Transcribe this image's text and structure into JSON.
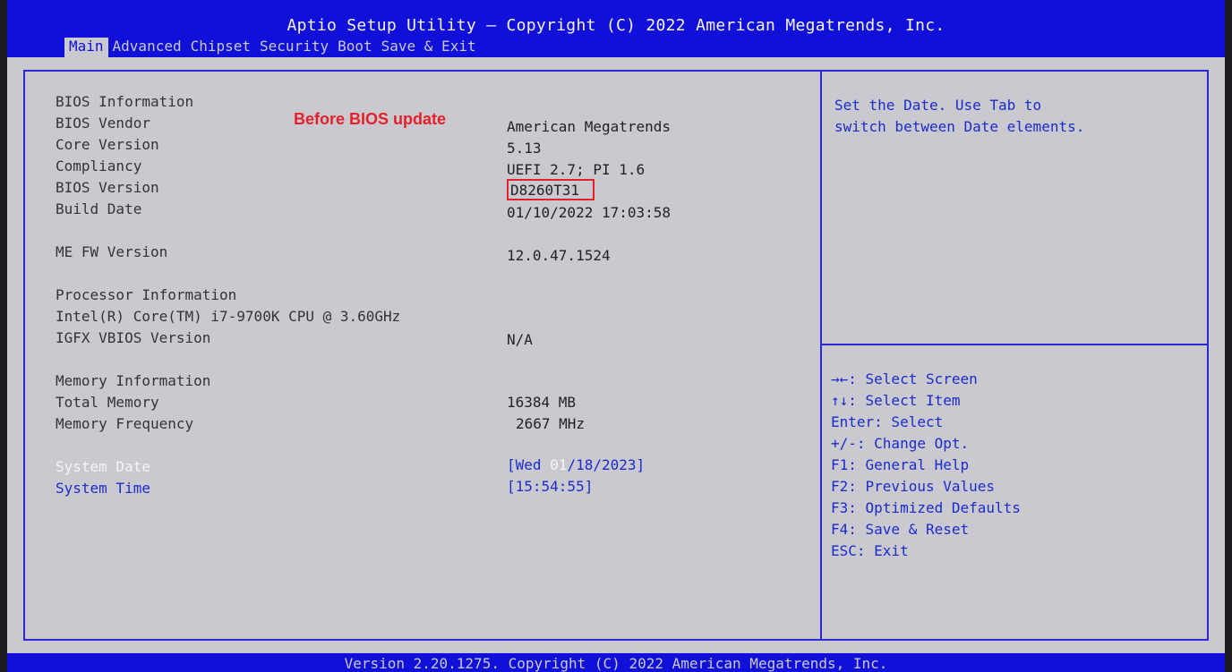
{
  "header": {
    "title": "Aptio Setup Utility – Copyright (C) 2022 American Megatrends, Inc.",
    "tabs": [
      "Main",
      "Advanced",
      "Chipset",
      "Security",
      "Boot",
      "Save & Exit"
    ]
  },
  "main": {
    "bios_info_heading": "BIOS Information",
    "bios_vendor_label": "BIOS Vendor",
    "bios_vendor_value": "American Megatrends",
    "core_version_label": "Core Version",
    "core_version_value": "5.13",
    "compliancy_label": "Compliancy",
    "compliancy_value": "UEFI 2.7; PI 1.6",
    "bios_version_label": "BIOS Version",
    "bios_version_value": "D8260T31",
    "build_date_label": "Build Date",
    "build_date_value": "01/10/2022 17:03:58",
    "me_fw_label": "ME FW Version",
    "me_fw_value": "12.0.47.1524",
    "processor_heading": "Processor Information",
    "processor_name": "Intel(R) Core(TM) i7-9700K CPU @ 3.60GHz",
    "igfx_label": "IGFX VBIOS Version",
    "igfx_value": "N/A",
    "memory_heading": "Memory Information",
    "total_memory_label": "Total Memory",
    "total_memory_value": "16384 MB",
    "memory_freq_label": "Memory Frequency",
    "memory_freq_value": "2667 MHz",
    "system_date_label": "System Date",
    "system_date_prefix": "[Wed ",
    "system_date_month": "01",
    "system_date_rest": "/18/2023]",
    "system_time_label": "System Time",
    "system_time_value": "[15:54:55]"
  },
  "annotation": {
    "callout_text": "Before BIOS update",
    "color": "#e5202a"
  },
  "help": {
    "line1": "Set the Date. Use Tab to",
    "line2": "switch between Date elements."
  },
  "hotkeys": [
    "→←: Select Screen",
    "↑↓: Select Item",
    "Enter: Select",
    "+/-: Change Opt.",
    "F1: General Help",
    "F2: Previous Values",
    "F3: Optimized Defaults",
    "F4: Save & Reset",
    "ESC: Exit"
  ],
  "footer": {
    "text": "Version 2.20.1275. Copyright (C) 2022 American Megatrends, Inc."
  },
  "colors": {
    "header_blue": "#1010d8",
    "panel_gray": "#c9c9cf",
    "text_blue": "#1b2bcc"
  }
}
